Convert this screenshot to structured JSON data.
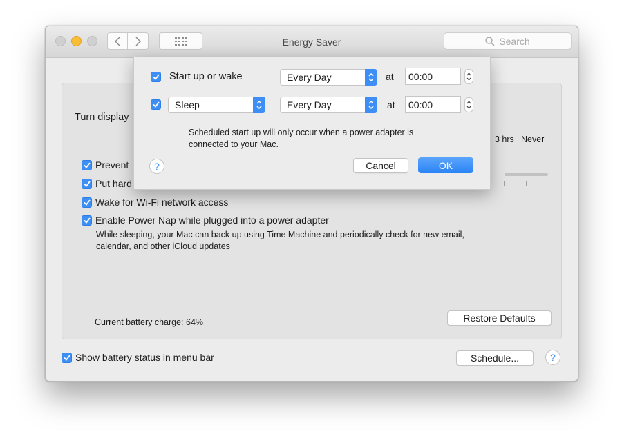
{
  "window": {
    "title": "Energy Saver",
    "search_placeholder": "Search"
  },
  "panel": {
    "turn_display_label": "Turn display",
    "slider_ticks": [
      "3 hrs",
      "Never"
    ],
    "options": [
      {
        "label": "Prevent",
        "checked": true
      },
      {
        "label": "Put hard",
        "checked": true
      },
      {
        "label": "Wake for Wi-Fi network access",
        "checked": true
      },
      {
        "label": "Enable Power Nap while plugged into a power adapter",
        "checked": true
      }
    ],
    "power_nap_desc_line1": "While sleeping, your Mac can back up using Time Machine and periodically check for new email,",
    "power_nap_desc_line2": "calendar, and other iCloud updates",
    "battery_charge": "Current battery charge: 64%",
    "restore_defaults": "Restore Defaults"
  },
  "footer": {
    "show_battery_status": "Show battery status in menu bar",
    "show_battery_checked": true,
    "schedule_button": "Schedule...",
    "help": "?"
  },
  "dialog": {
    "row1": {
      "checked": true,
      "label": "Start up or wake",
      "frequency": "Every Day",
      "at": "at",
      "time": "00:00"
    },
    "row2": {
      "checked": true,
      "action": "Sleep",
      "frequency": "Every Day",
      "at": "at",
      "time": "00:00"
    },
    "note_line1": "Scheduled start up will only occur when a power adapter is",
    "note_line2": "connected to your Mac.",
    "help": "?",
    "cancel": "Cancel",
    "ok": "OK"
  },
  "colors": {
    "accent": "#3d8ff5",
    "minimize": "#f8be35",
    "window_bg": "#ececec"
  },
  "icons": [
    "chevron-left-icon",
    "chevron-right-icon",
    "grid-icon",
    "search-icon",
    "checkmark-icon",
    "updown-arrows-icon",
    "stepper-icon",
    "help-icon"
  ]
}
